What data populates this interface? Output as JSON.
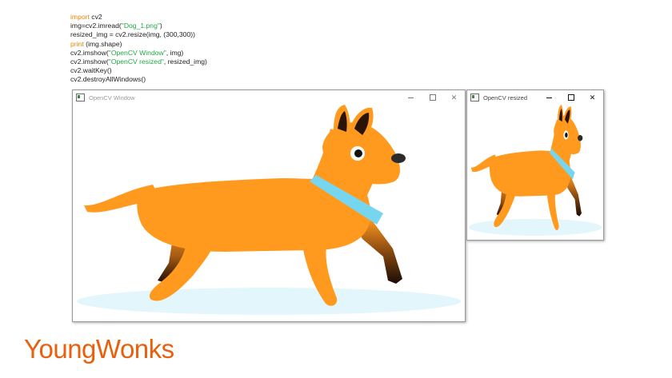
{
  "code": {
    "lines": [
      [
        {
          "t": "import",
          "c": "kw"
        },
        {
          "t": " cv2"
        }
      ],
      [
        {
          "t": "img=cv2.imread("
        },
        {
          "t": "\"Dog_1.png\"",
          "c": "str"
        },
        {
          "t": ")"
        }
      ],
      [
        {
          "t": "resized_img = cv2.resize(img, (300,300))"
        }
      ],
      [
        {
          "t": "print",
          "c": "kw"
        },
        {
          "t": " (img.shape)"
        }
      ],
      [
        {
          "t": "cv2.imshow("
        },
        {
          "t": "\"OpenCV Window\"",
          "c": "str"
        },
        {
          "t": ", img)"
        }
      ],
      [
        {
          "t": "cv2.imshow("
        },
        {
          "t": "\"OpenCV resized\"",
          "c": "str"
        },
        {
          "t": ", resized_img)"
        }
      ],
      [
        {
          "t": "cv2.waitKey()"
        }
      ],
      [
        {
          "t": "cv2.destroyAllWindows()"
        }
      ]
    ]
  },
  "windows": {
    "main": {
      "title": "OpenCV Window",
      "minimize": "—",
      "maximize": "□",
      "close": "✕"
    },
    "resized": {
      "title": "OpenCV resized",
      "minimize": "—",
      "maximize": "□",
      "close": "✕"
    }
  },
  "brand": {
    "name": "YoungWonks"
  },
  "colors": {
    "dog_body": "#ff9a1f",
    "collar": "#76d6ef",
    "shadow": "#e3f6fb",
    "brand": "#e8600c",
    "keyword": "#e8860a",
    "string": "#22a745"
  }
}
